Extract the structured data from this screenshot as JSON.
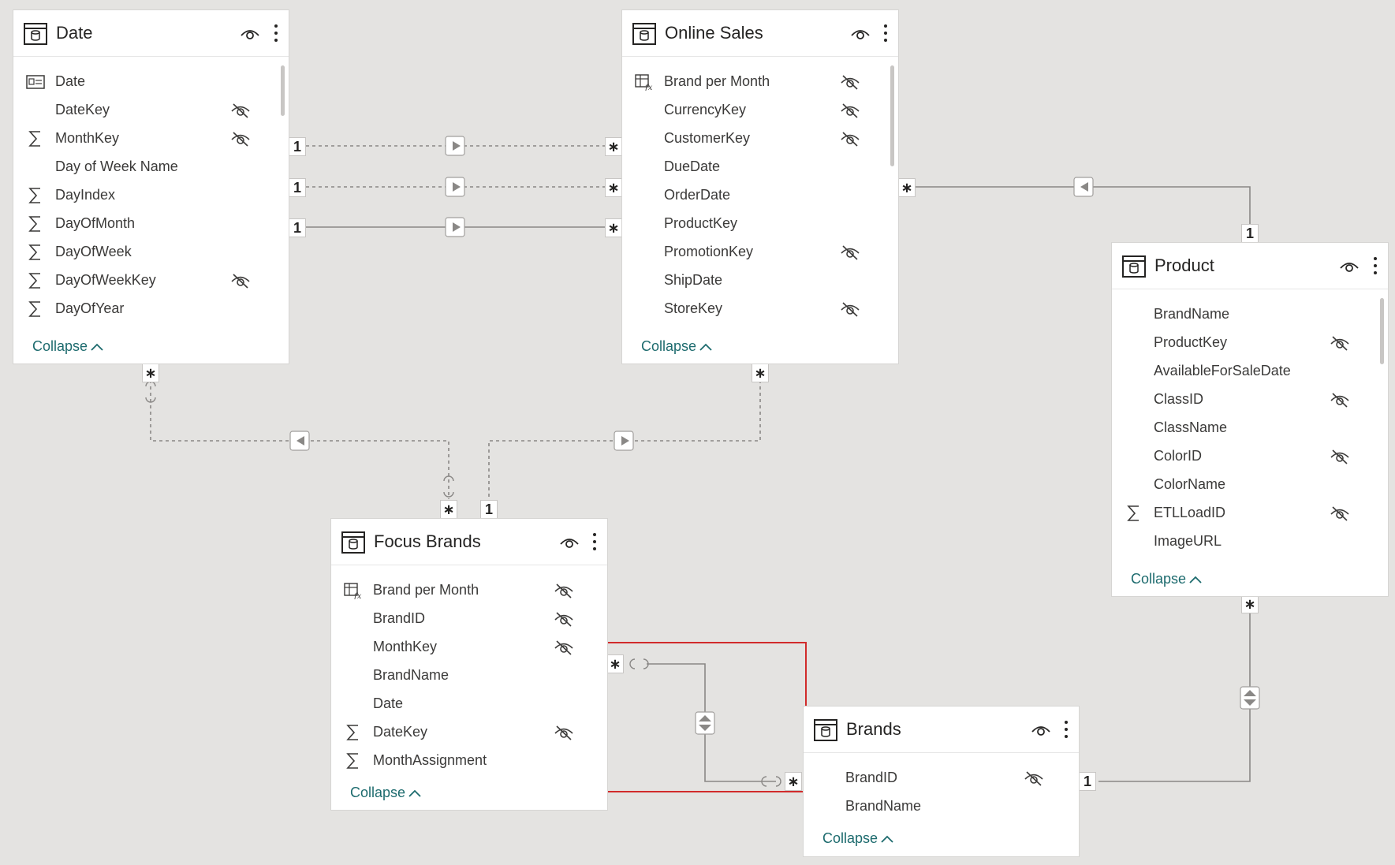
{
  "tables": {
    "date": {
      "title": "Date",
      "fields": [
        "Date",
        "DateKey",
        "MonthKey",
        "Day of Week Name",
        "DayIndex",
        "DayOfMonth",
        "DayOfWeek",
        "DayOfWeekKey",
        "DayOfYear"
      ],
      "collapse_label": "Collapse"
    },
    "online_sales": {
      "title": "Online Sales",
      "fields": [
        "Brand per Month",
        "CurrencyKey",
        "CustomerKey",
        "DueDate",
        "OrderDate",
        "ProductKey",
        "PromotionKey",
        "ShipDate",
        "StoreKey"
      ],
      "collapse_label": "Collapse"
    },
    "product": {
      "title": "Product",
      "fields": [
        "BrandName",
        "ProductKey",
        "AvailableForSaleDate",
        "ClassID",
        "ClassName",
        "ColorID",
        "ColorName",
        "ETLLoadID",
        "ImageURL"
      ],
      "collapse_label": "Collapse"
    },
    "focus_brands": {
      "title": "Focus Brands",
      "fields": [
        "Brand per Month",
        "BrandID",
        "MonthKey",
        "BrandName",
        "Date",
        "DateKey",
        "MonthAssignment"
      ],
      "collapse_label": "Collapse"
    },
    "brands": {
      "title": "Brands",
      "fields": [
        "BrandID",
        "BrandName"
      ],
      "collapse_label": "Collapse"
    }
  },
  "cardinality": {
    "one": "1",
    "many": "∗"
  },
  "icons": {
    "table": "table-icon",
    "visibility": "eye-icon",
    "more": "more-options-icon",
    "hidden": "hidden-eye-icon",
    "sum": "sigma-icon",
    "calendar": "date-field-icon",
    "calc_table": "calculated-table-icon",
    "collapse": "chevron-up-icon"
  },
  "colors": {
    "canvas": "#e4e3e1",
    "line": "#7a7978",
    "accent": "#1d6b6e",
    "highlight": "#d12b2b"
  }
}
